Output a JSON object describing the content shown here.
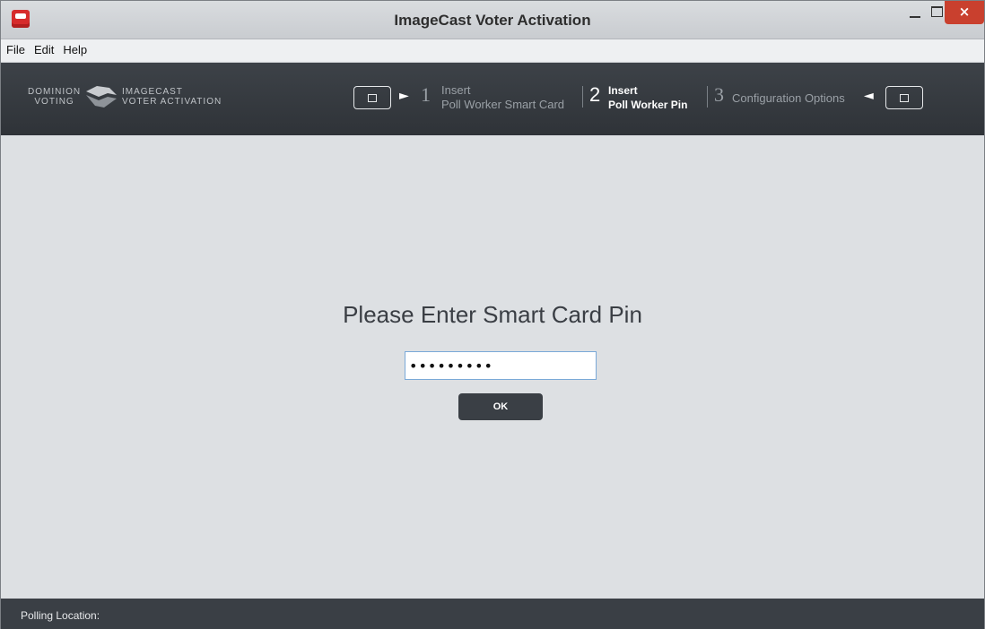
{
  "window": {
    "title": "ImageCast Voter Activation",
    "icon": "icva-app-icon",
    "close_glyph": "×"
  },
  "menu": {
    "items": [
      {
        "label": "File"
      },
      {
        "label": "Edit"
      },
      {
        "label": "Help"
      }
    ]
  },
  "header": {
    "logo_left_line1": "DOMINION",
    "logo_left_line2": "VOTING",
    "logo_right_line1": "IMAGECAST",
    "logo_right_line2": "VOTER ACTIVATION",
    "steps": [
      {
        "number": "1",
        "line1": "Insert",
        "line2": "Poll Worker Smart Card",
        "active": false
      },
      {
        "number": "2",
        "line1": "Insert",
        "line2": "Poll Worker Pin",
        "active": true
      },
      {
        "number": "3",
        "line1": "Configuration Options",
        "active": false
      }
    ],
    "arrow_right": "►",
    "arrow_left": "◄"
  },
  "main": {
    "prompt": "Please Enter Smart Card Pin",
    "pin_value": "•••••••••",
    "ok_label": "OK"
  },
  "status": {
    "label": "Polling Location:"
  },
  "colors": {
    "header_bg": "#33383d",
    "main_bg": "#dde0e3",
    "close_button": "#c9402e",
    "input_border": "#7aa9d8"
  }
}
